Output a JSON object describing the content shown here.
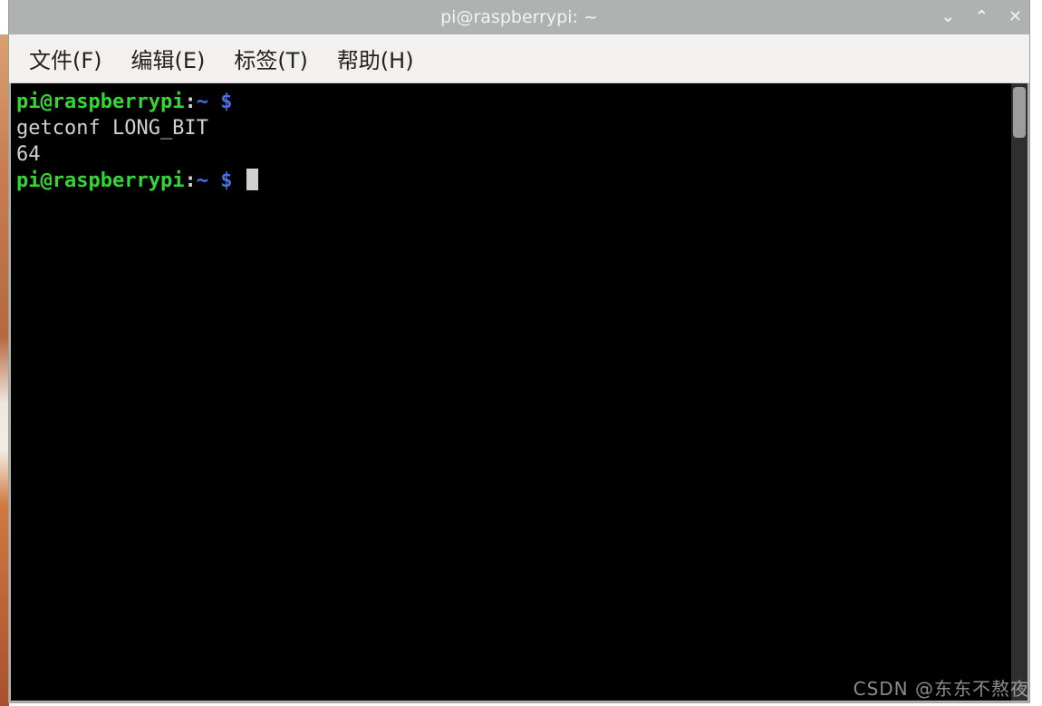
{
  "titlebar": {
    "title": "pi@raspberrypi: ~"
  },
  "menubar": {
    "items": [
      {
        "label": "文件(F)"
      },
      {
        "label": "编辑(E)"
      },
      {
        "label": "标签(T)"
      },
      {
        "label": "帮助(H)"
      }
    ]
  },
  "terminal": {
    "lines": [
      {
        "type": "prompt",
        "user": "pi",
        "at": "@",
        "host": "raspberrypi",
        "colon": ":",
        "path": "~",
        "space": " ",
        "dollar": "$",
        "cmd": ""
      },
      {
        "type": "text",
        "text": "getconf LONG_BIT"
      },
      {
        "type": "text",
        "text": "64"
      },
      {
        "type": "prompt",
        "user": "pi",
        "at": "@",
        "host": "raspberrypi",
        "colon": ":",
        "path": "~",
        "space": " ",
        "dollar": "$",
        "cmd": "",
        "cursor": true
      }
    ]
  },
  "watermark": "CSDN @东东不熬夜",
  "icons": {
    "minimize": "⌄",
    "maximize": "⌃",
    "close": "✕"
  }
}
